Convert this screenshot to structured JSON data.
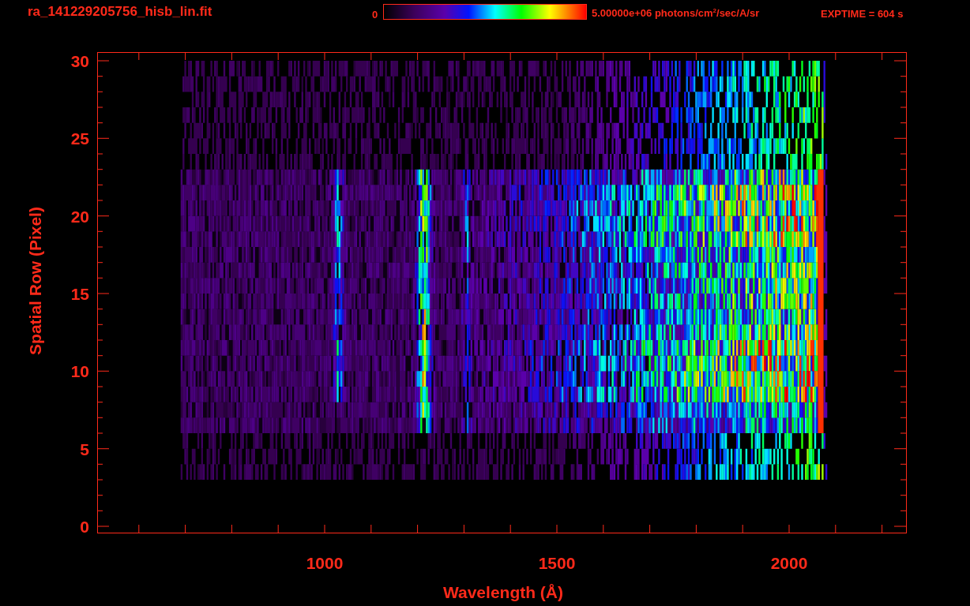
{
  "header": {
    "file_name": "ra_141229205756_hisb_lin.fit",
    "colorbar_min": "0",
    "colorbar_max": "5.00000e+06 photons/cm$^{2}$/sec/A/sr",
    "exposure": "EXPTIME = 604 s"
  },
  "y_axis": {
    "title": "Spatial Row (Pixel)",
    "tick_labels": [
      "30",
      "25",
      "20",
      "15",
      "10",
      "5",
      "0"
    ]
  },
  "x_axis": {
    "title": "Wavelength (Å)",
    "tick_labels": [
      "1000",
      "1500",
      "2000"
    ]
  }
}
